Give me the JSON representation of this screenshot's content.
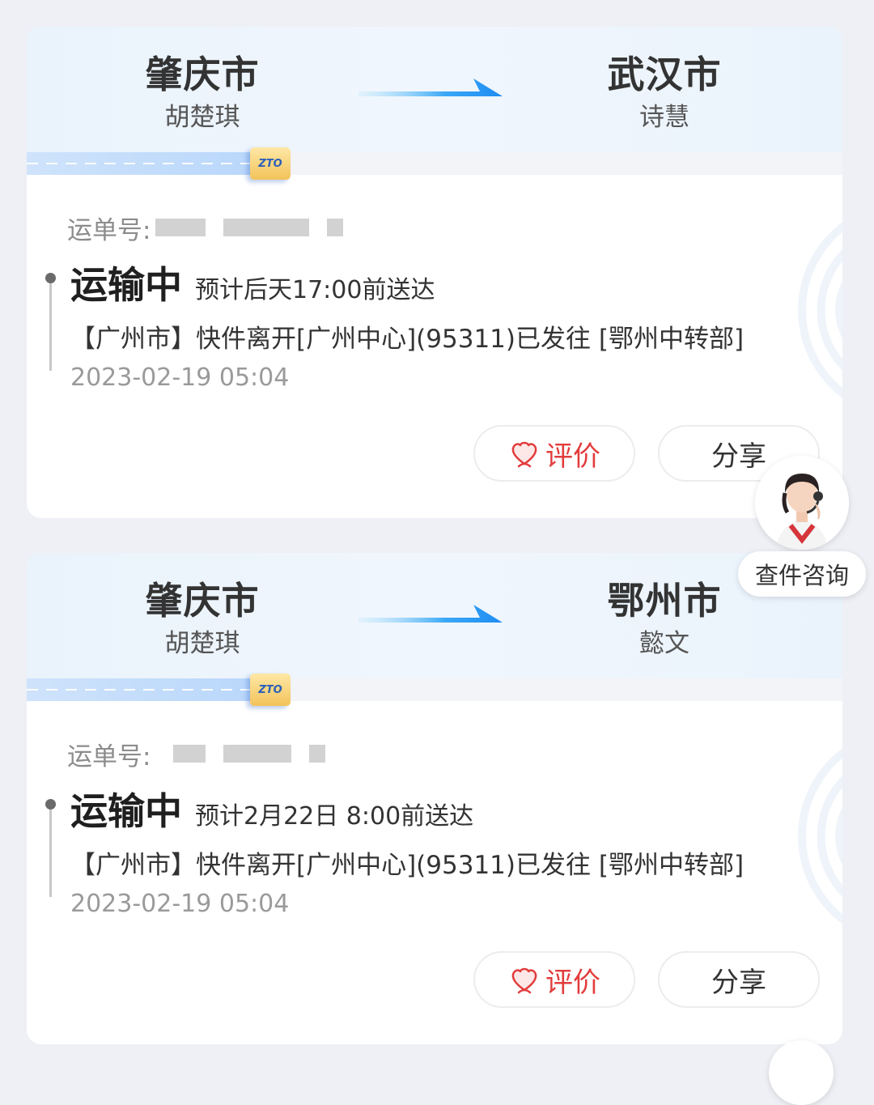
{
  "shipments": [
    {
      "from_city": "肇庆市",
      "from_person": "胡楚琪",
      "to_city": "武汉市",
      "to_person": "诗慧",
      "carrier_logo": "ZTO",
      "waybill_label": "运单号:",
      "status": "运输中",
      "eta": "预计后天17:00前送达",
      "latest_event": "【广州市】快件离开[广州中心](95311)已发往 [鄂州中转部]",
      "latest_time": "2023-02-19 05:04",
      "rate_label": "评价",
      "share_label": "分享"
    },
    {
      "from_city": "肇庆市",
      "from_person": "胡楚琪",
      "to_city": "鄂州市",
      "to_person": "懿文",
      "carrier_logo": "ZTO",
      "waybill_label": "运单号:",
      "status": "运输中",
      "eta": "预计2月22日 8:00前送达",
      "latest_event": "【广州市】快件离开[广州中心](95311)已发往 [鄂州中转部]",
      "latest_time": "2023-02-19 05:04",
      "rate_label": "评价",
      "share_label": "分享"
    }
  ],
  "help_widget": {
    "label": "查件咨询",
    "avatar_icon": "customer-service-agent-icon"
  },
  "colors": {
    "accent_blue": "#1f8cf2",
    "rate_red": "#e23c3c",
    "route_bg": "#eaf3fc"
  }
}
